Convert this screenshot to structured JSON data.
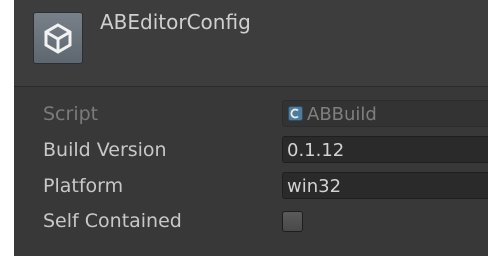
{
  "inspector": {
    "title": "ABEditorConfig",
    "icon": "unity-logo-icon",
    "fields": [
      {
        "label": "Script",
        "value": "ABBuild",
        "disabled": true,
        "icon": "csharp-script-icon"
      },
      {
        "label": "Build Version",
        "value": "0.1.12"
      },
      {
        "label": "Platform",
        "value": "win32"
      },
      {
        "label": "Self Contained",
        "checked": false
      }
    ]
  },
  "colors": {
    "panel_bg": "#383838",
    "field_bg": "#2a2a2a",
    "text": "#c8c8c8",
    "disabled_text": "#7b7b7b"
  }
}
